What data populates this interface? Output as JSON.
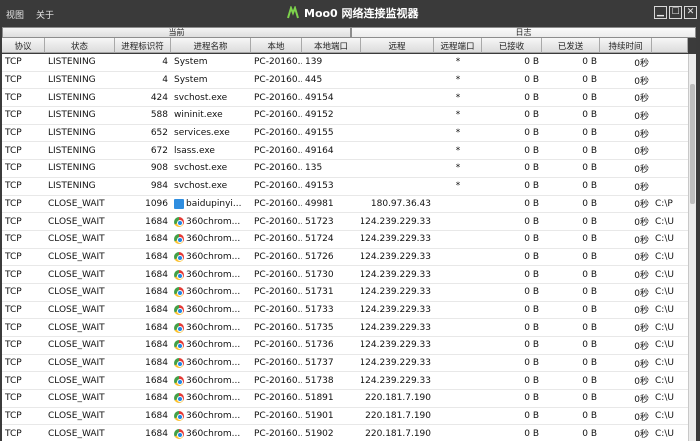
{
  "menu": [
    "视图",
    "关于"
  ],
  "app_title": "Moo0 网络连接监视器",
  "window_controls": {
    "minimize": "▁",
    "maximize": "☐",
    "close": "✕"
  },
  "tabs": {
    "current": "当前",
    "log": "日志"
  },
  "columns": [
    "协议",
    "状态",
    "进程标识符",
    "进程名称",
    "本地",
    "本地端口",
    "远程",
    "远程端口",
    "已接收",
    "已发送",
    "持续时间",
    ""
  ],
  "rows": [
    [
      "TCP",
      "LISTENING",
      "4",
      "",
      "System",
      "PC-20160...",
      "139",
      "",
      "*",
      "0 B",
      "0 B",
      "0秒",
      ""
    ],
    [
      "TCP",
      "LISTENING",
      "4",
      "",
      "System",
      "PC-20160...",
      "445",
      "",
      "*",
      "0 B",
      "0 B",
      "0秒",
      ""
    ],
    [
      "TCP",
      "LISTENING",
      "424",
      "",
      "svchost.exe",
      "PC-20160...",
      "49154",
      "",
      "*",
      "0 B",
      "0 B",
      "0秒",
      ""
    ],
    [
      "TCP",
      "LISTENING",
      "588",
      "",
      "wininit.exe",
      "PC-20160...",
      "49152",
      "",
      "*",
      "0 B",
      "0 B",
      "0秒",
      ""
    ],
    [
      "TCP",
      "LISTENING",
      "652",
      "",
      "services.exe",
      "PC-20160...",
      "49155",
      "",
      "*",
      "0 B",
      "0 B",
      "0秒",
      ""
    ],
    [
      "TCP",
      "LISTENING",
      "672",
      "",
      "lsass.exe",
      "PC-20160...",
      "49164",
      "",
      "*",
      "0 B",
      "0 B",
      "0秒",
      ""
    ],
    [
      "TCP",
      "LISTENING",
      "908",
      "",
      "svchost.exe",
      "PC-20160...",
      "135",
      "",
      "*",
      "0 B",
      "0 B",
      "0秒",
      ""
    ],
    [
      "TCP",
      "LISTENING",
      "984",
      "",
      "svchost.exe",
      "PC-20160...",
      "49153",
      "",
      "*",
      "0 B",
      "0 B",
      "0秒",
      ""
    ],
    [
      "TCP",
      "CLOSE_WAIT",
      "1096",
      "baidu",
      "baidupinyi...",
      "PC-20160...",
      "49981",
      "180.97.36.43",
      "",
      "0 B",
      "0 B",
      "0秒",
      "C:\\P"
    ],
    [
      "TCP",
      "CLOSE_WAIT",
      "1684",
      "chrome",
      "360chrom...",
      "PC-20160...",
      "51723",
      "124.239.229.33",
      "",
      "0 B",
      "0 B",
      "0秒",
      "C:\\U"
    ],
    [
      "TCP",
      "CLOSE_WAIT",
      "1684",
      "chrome",
      "360chrom...",
      "PC-20160...",
      "51724",
      "124.239.229.33",
      "",
      "0 B",
      "0 B",
      "0秒",
      "C:\\U"
    ],
    [
      "TCP",
      "CLOSE_WAIT",
      "1684",
      "chrome",
      "360chrom...",
      "PC-20160...",
      "51726",
      "124.239.229.33",
      "",
      "0 B",
      "0 B",
      "0秒",
      "C:\\U"
    ],
    [
      "TCP",
      "CLOSE_WAIT",
      "1684",
      "chrome",
      "360chrom...",
      "PC-20160...",
      "51730",
      "124.239.229.33",
      "",
      "0 B",
      "0 B",
      "0秒",
      "C:\\U"
    ],
    [
      "TCP",
      "CLOSE_WAIT",
      "1684",
      "chrome",
      "360chrom...",
      "PC-20160...",
      "51731",
      "124.239.229.33",
      "",
      "0 B",
      "0 B",
      "0秒",
      "C:\\U"
    ],
    [
      "TCP",
      "CLOSE_WAIT",
      "1684",
      "chrome",
      "360chrom...",
      "PC-20160...",
      "51733",
      "124.239.229.33",
      "",
      "0 B",
      "0 B",
      "0秒",
      "C:\\U"
    ],
    [
      "TCP",
      "CLOSE_WAIT",
      "1684",
      "chrome",
      "360chrom...",
      "PC-20160...",
      "51735",
      "124.239.229.33",
      "",
      "0 B",
      "0 B",
      "0秒",
      "C:\\U"
    ],
    [
      "TCP",
      "CLOSE_WAIT",
      "1684",
      "chrome",
      "360chrom...",
      "PC-20160...",
      "51736",
      "124.239.229.33",
      "",
      "0 B",
      "0 B",
      "0秒",
      "C:\\U"
    ],
    [
      "TCP",
      "CLOSE_WAIT",
      "1684",
      "chrome",
      "360chrom...",
      "PC-20160...",
      "51737",
      "124.239.229.33",
      "",
      "0 B",
      "0 B",
      "0秒",
      "C:\\U"
    ],
    [
      "TCP",
      "CLOSE_WAIT",
      "1684",
      "chrome",
      "360chrom...",
      "PC-20160...",
      "51738",
      "124.239.229.33",
      "",
      "0 B",
      "0 B",
      "0秒",
      "C:\\U"
    ],
    [
      "TCP",
      "CLOSE_WAIT",
      "1684",
      "chrome",
      "360chrom...",
      "PC-20160...",
      "51891",
      "220.181.7.190",
      "",
      "0 B",
      "0 B",
      "0秒",
      "C:\\U"
    ],
    [
      "TCP",
      "CLOSE_WAIT",
      "1684",
      "chrome",
      "360chrom...",
      "PC-20160...",
      "51901",
      "220.181.7.190",
      "",
      "0 B",
      "0 B",
      "0秒",
      "C:\\U"
    ],
    [
      "TCP",
      "CLOSE_WAIT",
      "1684",
      "chrome",
      "360chrom...",
      "PC-20160...",
      "51902",
      "220.181.7.190",
      "",
      "0 B",
      "0 B",
      "0秒",
      "C:\\U"
    ]
  ]
}
